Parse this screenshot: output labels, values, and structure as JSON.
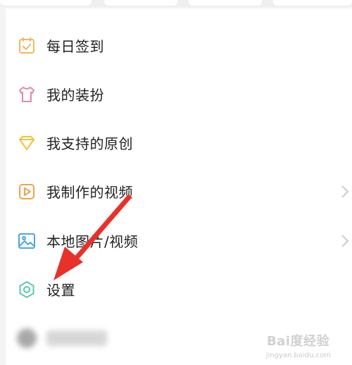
{
  "menu": {
    "items": [
      {
        "label": "每日签到",
        "icon": "calendar-check-icon",
        "color": "#f2b75a"
      },
      {
        "label": "我的装扮",
        "icon": "tshirt-icon",
        "color": "#e58aa3"
      },
      {
        "label": "我支持的原创",
        "icon": "diamond-icon",
        "color": "#f2c13f"
      },
      {
        "label": "我制作的视频",
        "icon": "video-play-icon",
        "color": "#f2a14a"
      },
      {
        "label": "本地图片/视频",
        "icon": "image-icon",
        "color": "#4aa6e6"
      },
      {
        "label": "设置",
        "icon": "gear-icon",
        "color": "#5cc8b0"
      }
    ]
  },
  "annotation": {
    "arrow_color": "#e8312a"
  },
  "watermark": {
    "brand": "Bai度经验",
    "url": "jingyan.baidu.com"
  }
}
